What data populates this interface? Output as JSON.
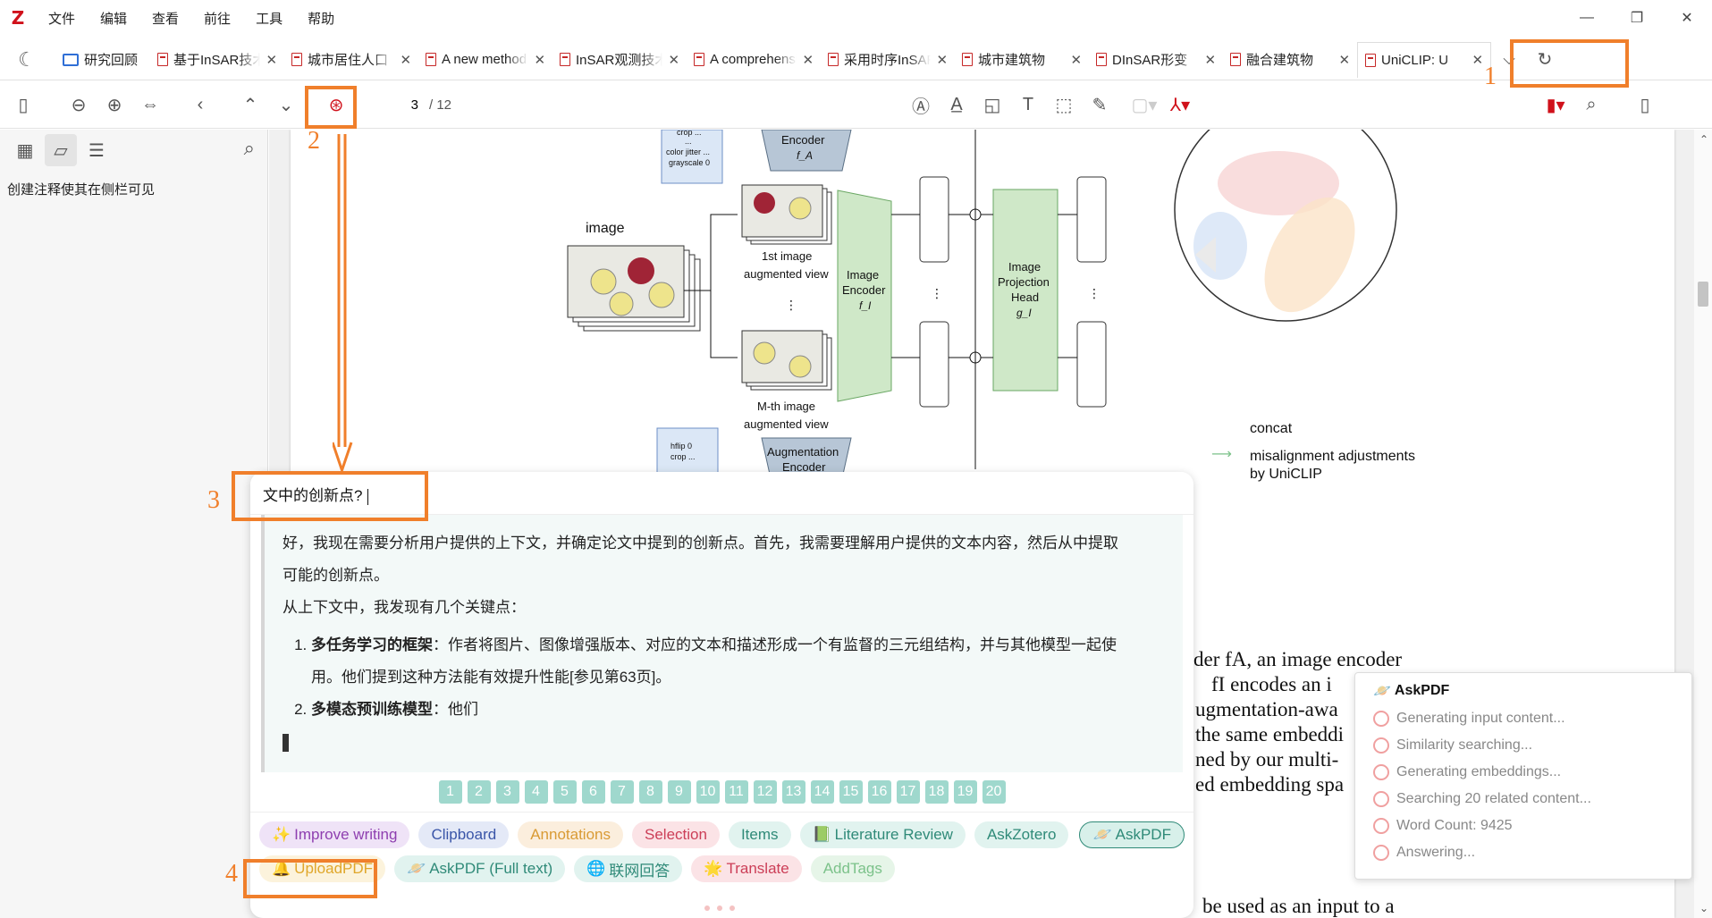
{
  "app": {
    "logo": "Z",
    "menu": [
      "文件",
      "编辑",
      "查看",
      "前往",
      "工具",
      "帮助"
    ],
    "window_controls": [
      "—",
      "❐",
      "✕"
    ]
  },
  "tabbar": {
    "library_tab": "研究回顾",
    "tabs": [
      {
        "title": "基于InSAR技术",
        "close": "✕"
      },
      {
        "title": "城市居住人口",
        "close": "✕"
      },
      {
        "title": "A new method",
        "close": "✕"
      },
      {
        "title": "InSAR观测技术",
        "close": "✕"
      },
      {
        "title": "A comprehensive",
        "close": "✕"
      },
      {
        "title": "采用时序InSAR",
        "close": "✕"
      },
      {
        "title": "城市建筑物",
        "close": "✕"
      },
      {
        "title": "DInSAR形变",
        "close": "✕"
      },
      {
        "title": "融合建筑物",
        "close": "✕"
      },
      {
        "title": "UniCLIP: U",
        "close": "✕"
      }
    ]
  },
  "toolbar": {
    "page_current": "3",
    "page_total": "/ 12"
  },
  "sidebar": {
    "hint": "创建注释使其在侧栏可见"
  },
  "document": {
    "diagram_labels": {
      "image": "image",
      "crop_top": "crop ...",
      "ellipsis_top": "...",
      "color_jitter": "color jitter ...",
      "grayscale": "grayscale 0",
      "encoder_top": "Encoder",
      "encoder_top_sym": "f_A",
      "first_view": "1st image",
      "first_view_2": "augmented view",
      "mth_view": "M-th image",
      "mth_view_2": "augmented view",
      "img_encoder": "Image",
      "img_encoder_2": "Encoder",
      "img_encoder_sym": "f_I",
      "proj_head": "Image",
      "proj_head_2": "Projection",
      "proj_head_3": "Head",
      "proj_head_sym": "g_I",
      "hflip": "hflip 0",
      "crop_bottom": "crop ...",
      "aug_encoder": "Augmentation",
      "aug_encoder_2": "Encoder",
      "concat": "concat",
      "misalign": "misalignment adjustments",
      "misalign_2": "by UniCLIP"
    },
    "paragraph_lines": [
      "der fA, an image encoder",
      "fI encodes an i",
      "ugmentation-awa",
      "the same embeddi",
      "ned by our multi-",
      "ed embedding spa"
    ],
    "bottom_line": "be used as an input to a"
  },
  "chat": {
    "question": "文中的创新点?",
    "answer_intro_1": "好，我现在需要分析用户提供的上下文，并确定论文中提到的创新点。首先，我需要理解用户提供的文本内容，然后从中提取",
    "answer_intro_2": "可能的创新点。",
    "answer_intro_3": "从上下文中，我发现有几个关键点：",
    "items": [
      {
        "bold": "多任务学习的框架",
        "text": "：作者将图片、图像增强版本、对应的文本和描述形成一个有监督的三元组结构，并与其他模型一起使",
        "text2": "用。他们提到这种方法能有效提升性能[参见第63页]。"
      },
      {
        "bold": "多模态预训练模型",
        "text": "：他们",
        "text2": ""
      }
    ],
    "pages": [
      "1",
      "2",
      "3",
      "4",
      "5",
      "6",
      "7",
      "8",
      "9",
      "10",
      "11",
      "12",
      "13",
      "14",
      "15",
      "16",
      "17",
      "18",
      "19",
      "20"
    ],
    "actions": [
      {
        "label": "Improve writing",
        "icon": "✨",
        "bg": "#efe3f7",
        "fg": "#8e3fb0"
      },
      {
        "label": "Clipboard",
        "icon": "",
        "bg": "#e4e9f7",
        "fg": "#3a55a8"
      },
      {
        "label": "Annotations",
        "icon": "",
        "bg": "#fbeedd",
        "fg": "#d99a34"
      },
      {
        "label": "Selection",
        "icon": "",
        "bg": "#fbe3e6",
        "fg": "#cc3e57"
      },
      {
        "label": "Items",
        "icon": "",
        "bg": "#e1f3ef",
        "fg": "#2f8a78"
      },
      {
        "label": "Literature Review",
        "icon": "📗",
        "bg": "#e1f3ef",
        "fg": "#2f8a78"
      },
      {
        "label": "AskZotero",
        "icon": "",
        "bg": "#e1f3ef",
        "fg": "#2f8a78"
      },
      {
        "label": "AskPDF",
        "icon": "🪐",
        "bg": "#d8f0ea",
        "fg": "#2f8a78"
      },
      {
        "label": "UploadPDF",
        "icon": "🔔",
        "bg": "#fcf3dc",
        "fg": "#e0a72a"
      },
      {
        "label": "AskPDF (Full text)",
        "icon": "🪐",
        "bg": "#e1f3ef",
        "fg": "#2f8a78"
      },
      {
        "label": "联网回答",
        "icon": "🌐",
        "bg": "#e1f3ef",
        "fg": "#2f8a78"
      },
      {
        "label": "Translate",
        "icon": "🌟",
        "bg": "#fbe3e6",
        "fg": "#cc3e57"
      },
      {
        "label": "AddTags",
        "icon": "",
        "bg": "#e6f5e8",
        "fg": "#7cc28a"
      }
    ]
  },
  "status": {
    "title": "AskPDF",
    "steps": [
      "Generating input content...",
      "Similarity searching...",
      "Generating embeddings...",
      "Searching 20 related content...",
      "Word Count: 9425",
      "Answering..."
    ]
  },
  "annotations": [
    "1",
    "2",
    "3",
    "4"
  ],
  "colors": {
    "accent": "#f07f2b",
    "zotero_red": "#d0111b"
  }
}
